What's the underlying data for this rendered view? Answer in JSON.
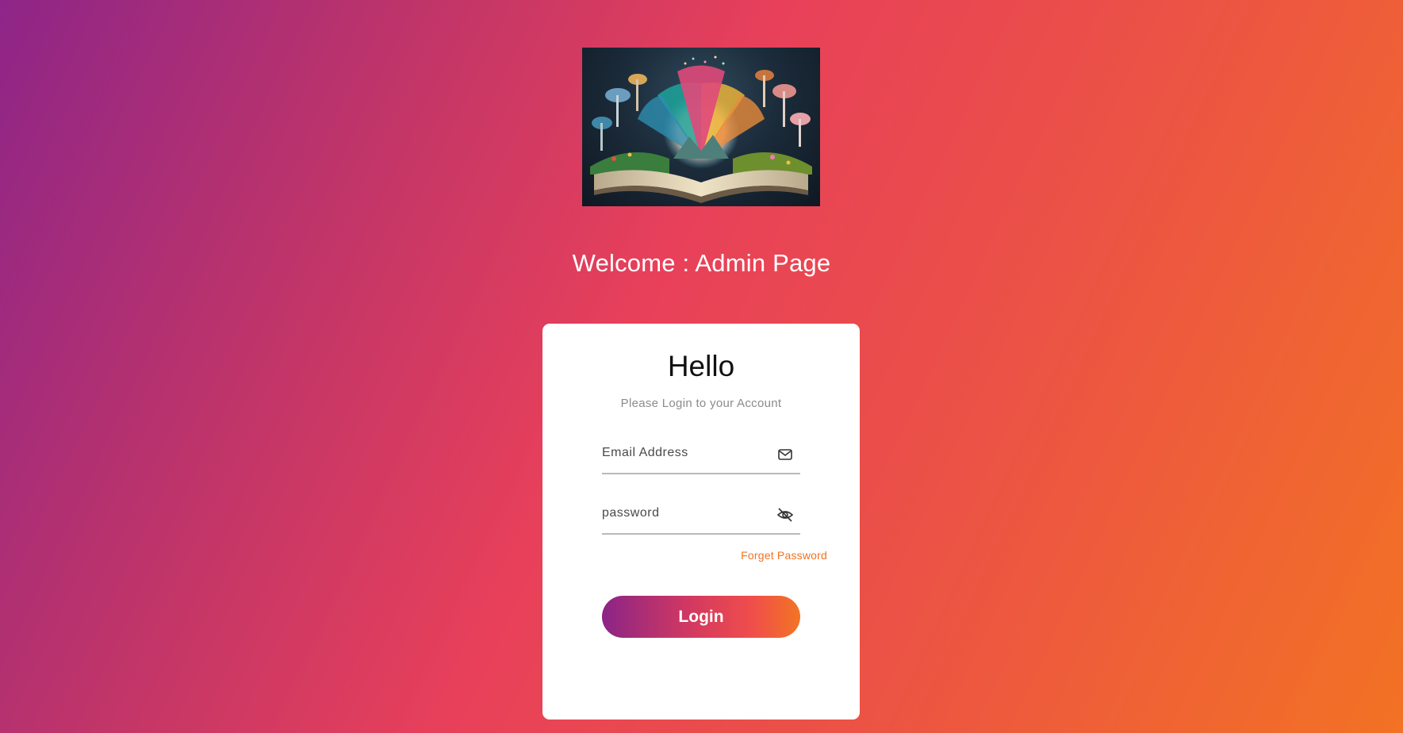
{
  "hero_image": {
    "alt": ""
  },
  "welcome": {
    "title": "Welcome : Admin Page"
  },
  "login_card": {
    "heading": "Hello",
    "subtitle": "Please Login to your Account",
    "email": {
      "placeholder": "Email Address",
      "value": "",
      "icon": "envelope-icon"
    },
    "password": {
      "placeholder": "password",
      "value": "",
      "icon": "eye-off-icon"
    },
    "forget_password": "Forget Password",
    "login_button": "Login"
  },
  "colors": {
    "gradient_start": "#8e2588",
    "gradient_mid": "#e8405a",
    "gradient_end": "#f37224",
    "accent_link": "#f07321",
    "card": "#ffffff"
  }
}
